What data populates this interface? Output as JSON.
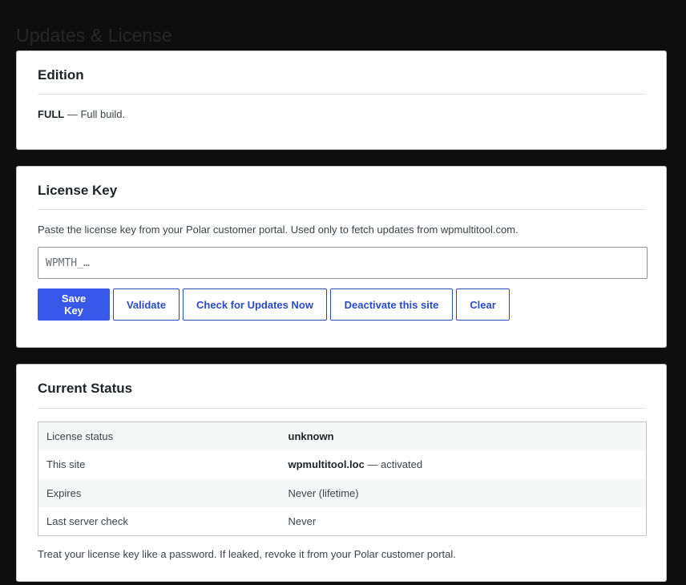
{
  "page": {
    "title": "Updates & License"
  },
  "edition": {
    "title": "Edition",
    "value": "FULL",
    "description": " — Full build."
  },
  "license": {
    "title": "License Key",
    "help": "Paste the license key from your Polar customer portal. Used only to fetch updates from wpmultitool.com.",
    "input_placeholder": "WPMTH_…",
    "input_value": "",
    "buttons": {
      "save": "Save Key",
      "validate": "Validate",
      "check_updates": "Check for Updates Now",
      "deactivate": "Deactivate this site",
      "clear": "Clear"
    }
  },
  "status": {
    "title": "Current Status",
    "rows": [
      {
        "label": "License status",
        "value": "unknown",
        "suffix": ""
      },
      {
        "label": "This site",
        "value": "wpmultitool.loc",
        "suffix": " — activated"
      },
      {
        "label": "Expires",
        "value": "",
        "suffix": "Never (lifetime)"
      },
      {
        "label": "Last server check",
        "value": "",
        "suffix": "Never"
      }
    ],
    "footer_note": "Treat your license key like a password. If leaked, revoke it from your Polar customer portal."
  },
  "colors": {
    "background": "#0e0e0e",
    "card": "#ffffff",
    "primary": "#3858e9",
    "secondary_text": "#2b49c8"
  }
}
